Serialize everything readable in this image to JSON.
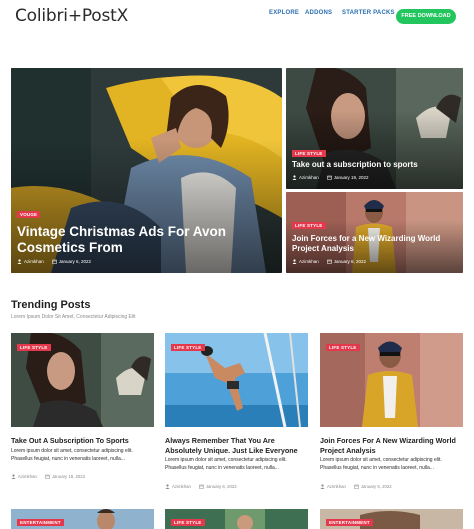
{
  "header": {
    "logo": "Colibri+PostX",
    "nav": [
      "EXPLORE",
      "ADDONS",
      "STARTER PACKS"
    ],
    "cta": "FREE DOWNLOAD"
  },
  "hero": {
    "main": {
      "category": "VOUGE",
      "title": "Vintage Christmas Ads For Avon Cosmetics From",
      "author": "Azimkhan",
      "date": "January 6, 2022"
    },
    "side": [
      {
        "category": "LIFE STYLE",
        "title": "Take out a subscription to sports",
        "author": "Azimkhan",
        "date": "January 19, 2022"
      },
      {
        "category": "LIFE STYLE",
        "title": "Join Forces for a New Wizarding World Project Analysis",
        "author": "Azimkhan",
        "date": "January 6, 2022"
      }
    ]
  },
  "trending": {
    "title": "Trending Posts",
    "subtitle": "Lorem Ipsum Dolor Sit Amet, Consectetur Adipiscing Elit",
    "posts": [
      {
        "category": "LIFE STYLE",
        "title": "Take Out A Subscription To Sports",
        "excerpt": "Lorem ipsum dolor sit amet, consectetur adipiscing elit. Phasellus feugiat, nunc in venenatis laoreet, nulla...",
        "author": "Azimkhan",
        "date": "January 19, 2022"
      },
      {
        "category": "LIFE STYLE",
        "title": "Always Remember That You Are Absolutely Unique. Just Like Everyone",
        "excerpt": "Lorem ipsum dolor sit amet, consectetur adipiscing elit. Phasellus feugiat, nunc in venenatis laoreet, nulla...",
        "author": "Azimkhan",
        "date": "January 6, 2022"
      },
      {
        "category": "LIFE STYLE",
        "title": "Join Forces For A New Wizarding World Project Analysis",
        "excerpt": "Lorem ipsum dolor sit amet, consectetur adipiscing elit. Phasellus feugiat, nunc in venenatis laoreet, nulla...",
        "author": "Azimkhan",
        "date": "January 6, 2022"
      }
    ],
    "next_row_categories": [
      "ENTERTAINMENT",
      "LIFE STYLE",
      "ENTERTAINMENT"
    ]
  },
  "colors": {
    "accent_badge": "#e4394d",
    "cta_green": "#22c55e",
    "nav_blue": "#2a6fb0"
  }
}
